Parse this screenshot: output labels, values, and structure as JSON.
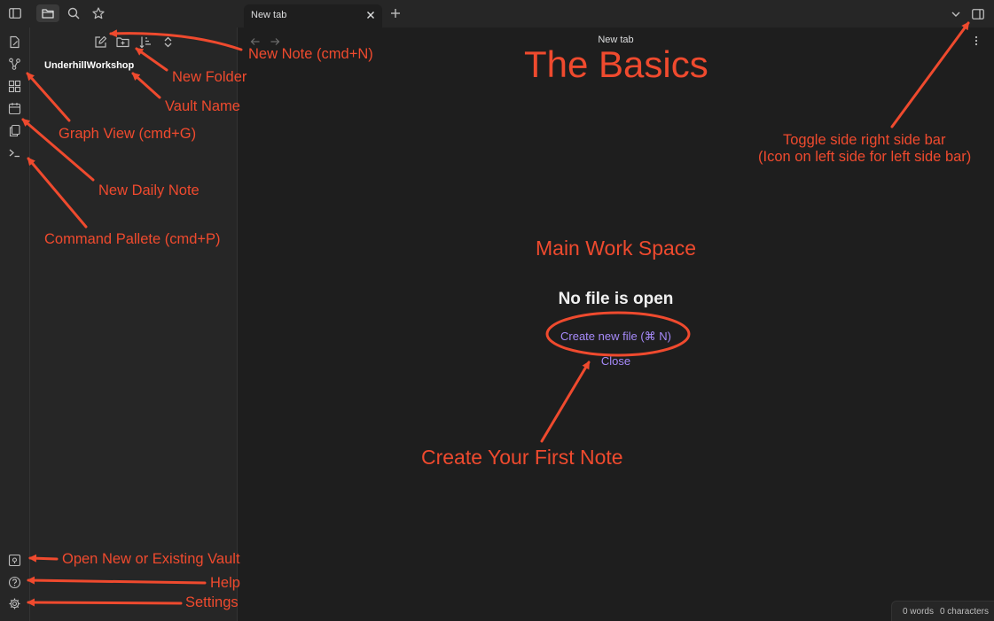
{
  "topbar": {
    "tab_title": "New tab",
    "icons": [
      "sidebar-toggle-icon",
      "folder-icon",
      "search-icon",
      "star-icon",
      "close-icon",
      "plus-icon",
      "chevron-down-icon",
      "right-sidebar-toggle-icon"
    ]
  },
  "ribbon": {
    "icons": [
      "new-note-icon",
      "graph-view-icon",
      "canvas-icon",
      "daily-note-icon",
      "templates-icon",
      "command-palette-icon",
      "open-vault-icon",
      "help-icon",
      "settings-icon"
    ]
  },
  "sidebar": {
    "vault_name": "UnderhillWorkshop",
    "icons": [
      "new-note-icon",
      "new-folder-icon",
      "sort-icon",
      "expand-collapse-icon"
    ]
  },
  "main": {
    "view_title": "New tab",
    "empty_title": "No file is open",
    "create_link": "Create new file (⌘ N)",
    "close_link": "Close"
  },
  "statusbar": {
    "words": "0 words",
    "characters": "0 characters"
  },
  "annotations": {
    "title": "The Basics",
    "new_note": "New Note (cmd+N)",
    "new_folder": "New Folder",
    "vault_name": "Vault Name",
    "graph_view": "Graph View (cmd+G)",
    "new_daily_note": "New Daily Note",
    "command_palette": "Command Pallete (cmd+P)",
    "toggle_sidebar_1": "Toggle side right side bar",
    "toggle_sidebar_2": "(Icon on left side for left side bar)",
    "main_work_space": "Main Work Space",
    "create_first_note": "Create Your First Note",
    "open_vault": "Open New or Existing Vault",
    "help": "Help",
    "settings": "Settings"
  },
  "colors": {
    "annotation": "#ef4a2e",
    "link": "#a68af9",
    "background": "#1e1e1e",
    "panel": "#262626"
  }
}
